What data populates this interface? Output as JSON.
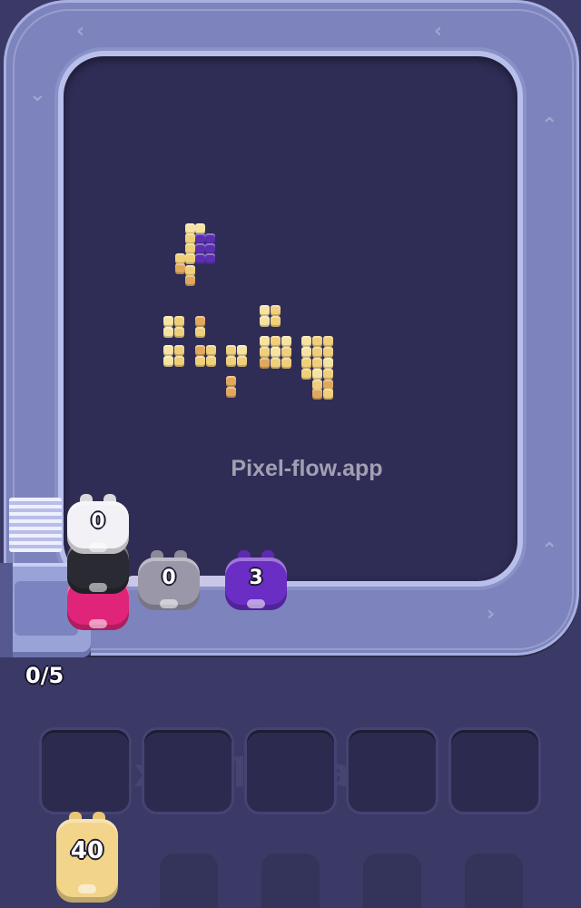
{
  "board": {
    "watermark_text": "Pixel-flow.app",
    "pixel_colors": {
      "gold": "#f0cf7a",
      "gold_light": "#f6e3a2",
      "gold_dark": "#e0a85c",
      "purple": "#5a2fb0"
    }
  },
  "conveyor_pigs": [
    {
      "name": "white-pig",
      "count": "0",
      "color": "#f2f2f6"
    },
    {
      "name": "black-pig",
      "count": "",
      "color": "#2a2a32"
    },
    {
      "name": "pink-pig",
      "count": "",
      "color": "#e0247a"
    },
    {
      "name": "gray-pig",
      "count": "0",
      "color": "#9a98a8"
    },
    {
      "name": "purple-pig",
      "count": "3",
      "color": "#6a2ec4"
    }
  ],
  "slots_counter": "0/5",
  "slots": [
    {
      "label": "slot-1"
    },
    {
      "label": "slot-2"
    },
    {
      "label": "slot-3"
    },
    {
      "label": "slot-4"
    },
    {
      "label": "slot-5"
    }
  ],
  "queue": {
    "front_pig_count": "40",
    "front_pig_color": "#f2d48a"
  }
}
